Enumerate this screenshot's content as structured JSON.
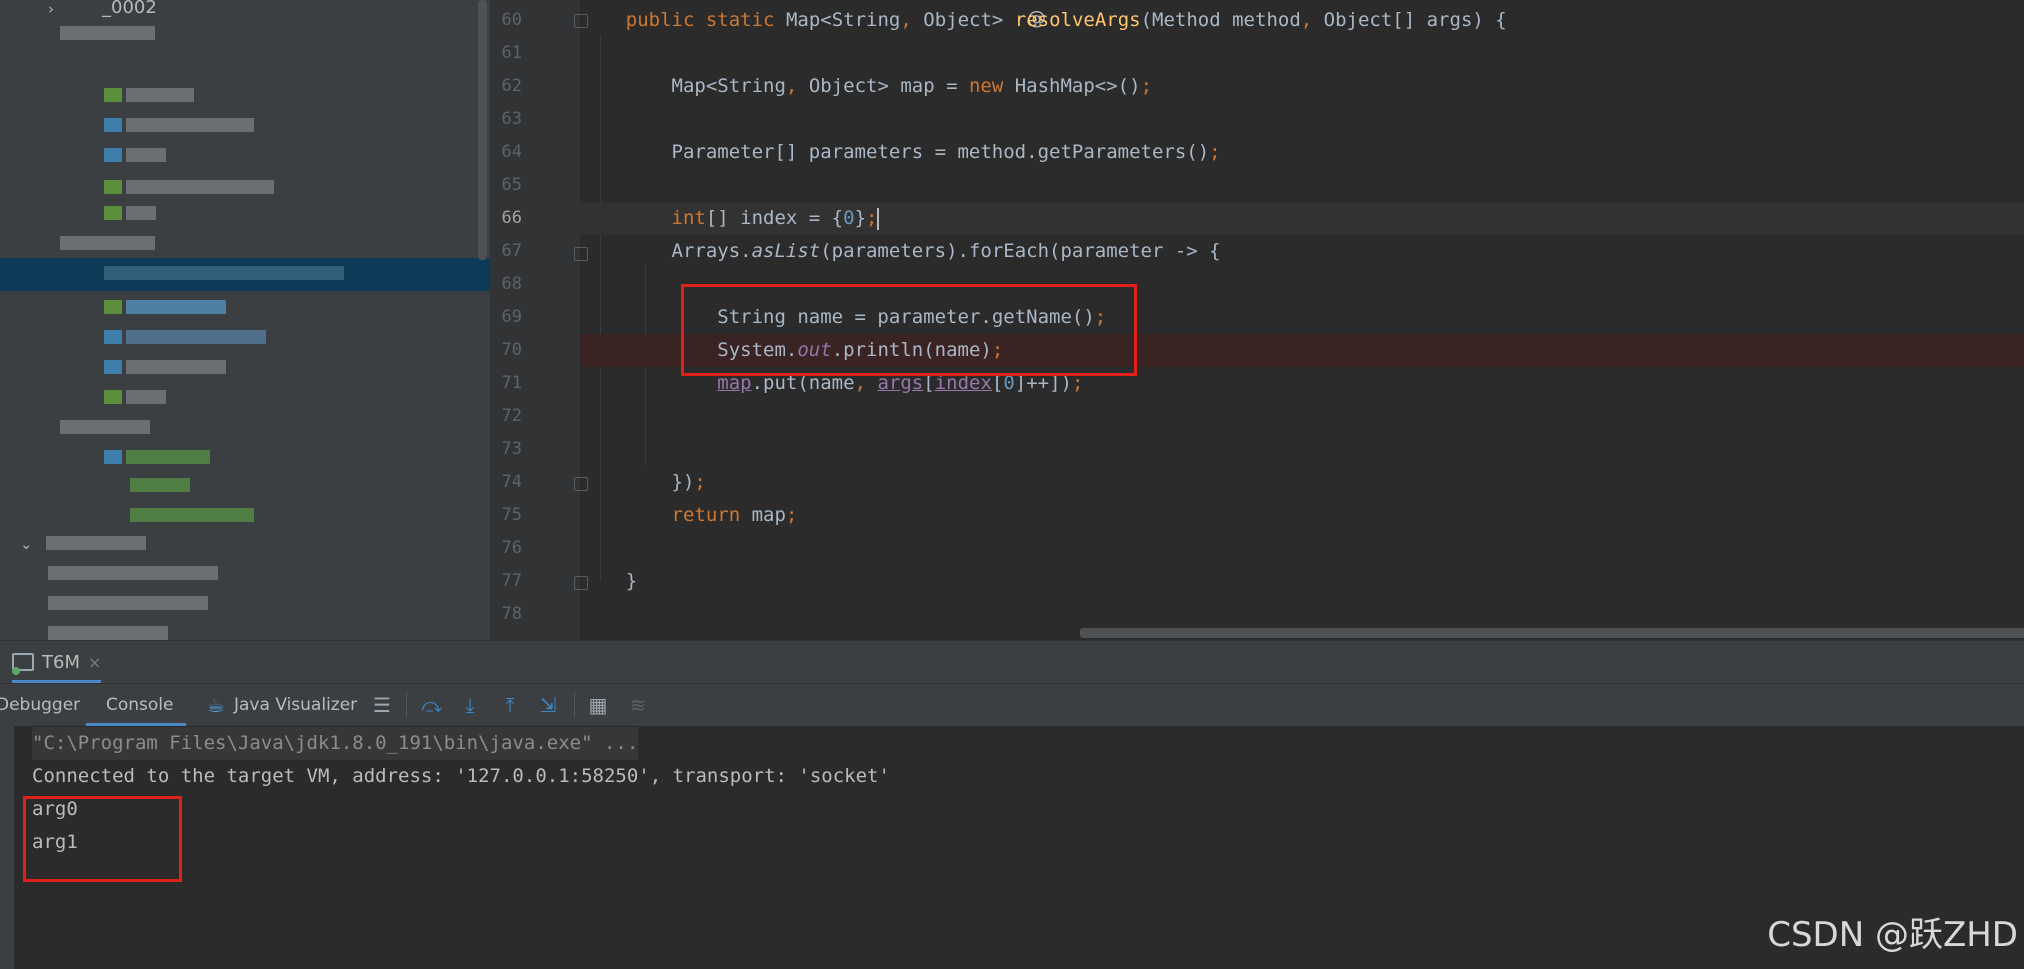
{
  "project_tree": {
    "top_item_label": "_0002"
  },
  "editor": {
    "lines": [
      {
        "num": "60",
        "text": ""
      },
      {
        "num": "61",
        "text": ""
      },
      {
        "num": "62",
        "text": ""
      },
      {
        "num": "63",
        "text": ""
      },
      {
        "num": "64",
        "text": ""
      },
      {
        "num": "65",
        "text": ""
      },
      {
        "num": "66",
        "text": ""
      },
      {
        "num": "67",
        "text": ""
      },
      {
        "num": "68",
        "text": ""
      },
      {
        "num": "69",
        "text": ""
      },
      {
        "num": "70",
        "text": ""
      },
      {
        "num": "71",
        "text": ""
      },
      {
        "num": "72",
        "text": ""
      },
      {
        "num": "73",
        "text": ""
      },
      {
        "num": "74",
        "text": ""
      },
      {
        "num": "75",
        "text": ""
      },
      {
        "num": "76",
        "text": ""
      },
      {
        "num": "77",
        "text": ""
      },
      {
        "num": "78",
        "text": ""
      }
    ],
    "code": {
      "l60": [
        "public",
        "static",
        "Map<String",
        "Object> ",
        "resolveArgs",
        "(Method method",
        "Object[] args) {"
      ],
      "l62": [
        "Map<String",
        "Object> map = ",
        "new",
        " HashMap<>()",
        ";"
      ],
      "l64": [
        "Parameter[] parameters = method.getParameters()",
        ";"
      ],
      "l66": [
        "int",
        "[] index = {",
        "0",
        "}",
        ";"
      ],
      "l67": [
        "Arrays.",
        "asList",
        "(parameters).forEach(parameter -> {"
      ],
      "l69": [
        "String name = parameter.getName()",
        ";"
      ],
      "l70": [
        "System.",
        "out",
        ".println(name)",
        ";"
      ],
      "l71": [
        "map",
        ".put(name",
        "args",
        "[",
        "index",
        "[",
        "0",
        "]++])",
        ";"
      ],
      "l74": [
        "})",
        ";"
      ],
      "l75": [
        "return",
        " map",
        ";"
      ],
      "l77": [
        "}"
      ],
      "comma": ","
    },
    "gutter_at_icon": "@"
  },
  "debug": {
    "session_tab": "T6M",
    "close_glyph": "×",
    "tabs": {
      "debugger": "Debugger",
      "console": "Console",
      "java_visualizer": "Java Visualizer"
    },
    "icons": [
      "menu-icon",
      "step-over-icon",
      "step-into-icon",
      "step-out-icon",
      "run-to-cursor-icon",
      "evaluate-icon",
      "trace-icon"
    ]
  },
  "console": {
    "lines": [
      "\"C:\\Program Files\\Java\\jdk1.8.0_191\\bin\\java.exe\" ...",
      "Connected to the target VM, address: '127.0.0.1:58250', transport: 'socket'",
      "arg0",
      "arg1"
    ]
  },
  "watermark": "CSDN @跃ZHD",
  "colors": {
    "highlight_box": "#e0201a",
    "keyword": "#cc7832",
    "method": "#ffc66d",
    "number": "#6897bb",
    "field": "#9876aa",
    "breakpoint": "#c75450"
  }
}
